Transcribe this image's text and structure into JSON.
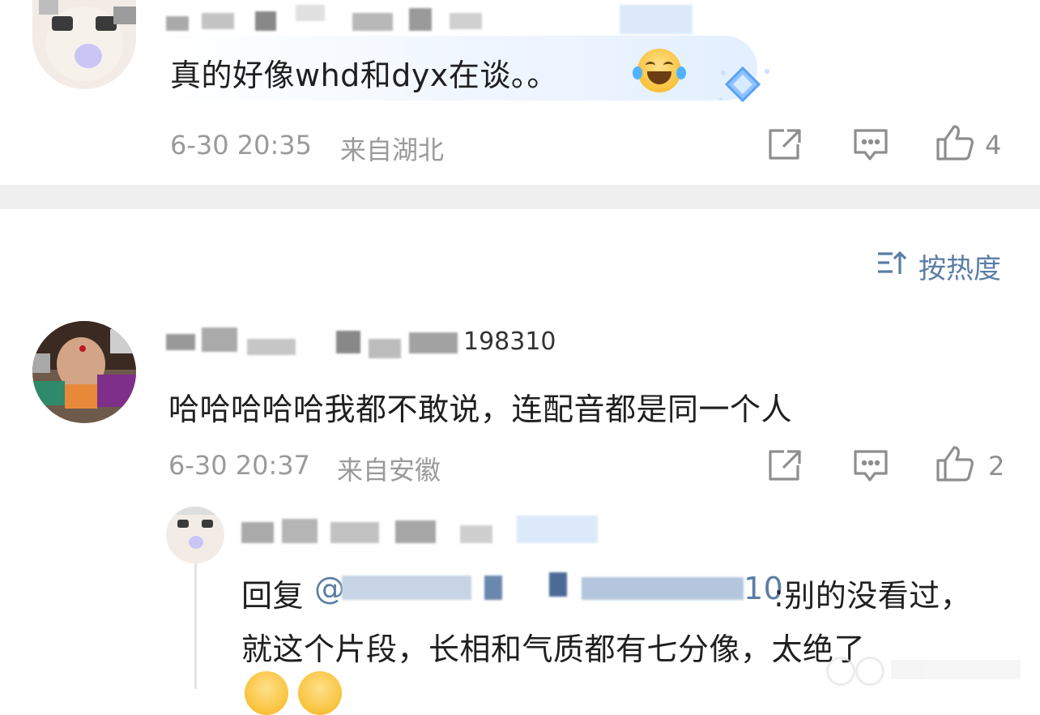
{
  "comments": [
    {
      "text": "真的好像whd和dyx在谈。。",
      "time": "6-30 20:35",
      "location": "来自湖北",
      "likes": "4",
      "emoji": "laughing-tears-emoji"
    },
    {
      "username_visible": "198310",
      "text": "哈哈哈哈哈我都不敢说，连配音都是同一个人",
      "time": "6-30 20:37",
      "location": "来自安徽",
      "likes": "2"
    }
  ],
  "sort": {
    "label": "按热度",
    "icon": "sort-icon"
  },
  "reply": {
    "prefix": "回复",
    "mention_visible": "@",
    "mention_suffix": "10",
    "line1_tail": ":别的没看过，",
    "line2": "就这个片段，长相和气质都有七分像，太绝了"
  },
  "icons": {
    "share": "share-icon",
    "comment": "comment-icon",
    "like": "thumbs-up-icon"
  },
  "colors": {
    "accent": "#5b7ea5",
    "meta": "#9a9a9a",
    "highlight_bubble": "#eaf3ff"
  }
}
